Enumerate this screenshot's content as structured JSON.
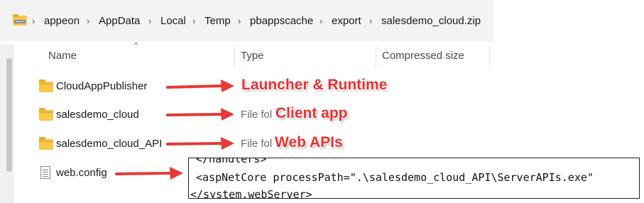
{
  "address_bar": {
    "icon": "folder-path-icon",
    "segments": [
      "appeon",
      "AppData",
      "Local",
      "Temp",
      "pbappscache",
      "export",
      "salesdemo_cloud.zip"
    ]
  },
  "columns": {
    "name": "Name",
    "type": "Type",
    "compressed_size": "Compressed size"
  },
  "rows": [
    {
      "name": "CloudAppPublisher",
      "type": "",
      "icon": "folder-icon"
    },
    {
      "name": "salesdemo_cloud",
      "type": "File fol",
      "icon": "folder-icon"
    },
    {
      "name": "salesdemo_cloud_API",
      "type": "File fol",
      "icon": "folder-icon"
    },
    {
      "name": "web.config",
      "type": "",
      "icon": "document-icon"
    }
  ],
  "annotations": {
    "launcher": "Launcher & Runtime",
    "client": "Client app",
    "webapi": "Web APIs"
  },
  "code_snippet": [
    "</handlers>",
    "<aspNetCore processPath=\".\\salesdemo_cloud_API\\ServerAPIs.exe\"",
    "</system.webServer>"
  ],
  "colors": {
    "annotation_red": "#e83030",
    "folder_yellow": "#f8c74b",
    "arrow_red": "#e53935"
  }
}
